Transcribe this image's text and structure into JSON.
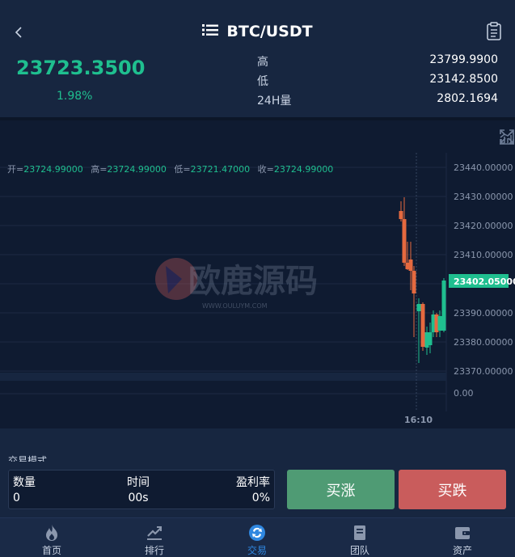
{
  "header": {
    "title": "BTC/USDT",
    "price": "23723.3500",
    "change_pct": "1.98%",
    "stats": [
      {
        "label": "高",
        "value": "23799.9900"
      },
      {
        "label": "低",
        "value": "23142.8500"
      },
      {
        "label": "24H量",
        "value": "2802.1694"
      }
    ]
  },
  "chart": {
    "ohlc_line": [
      {
        "label": "开=",
        "value": "23724.99000"
      },
      {
        "label": "高=",
        "value": "23724.99000"
      },
      {
        "label": "低=",
        "value": "23721.47000"
      },
      {
        "label": "收=",
        "value": "23724.99000"
      }
    ],
    "price_ticks": [
      "23440.00000",
      "23430.00000",
      "23420.00000",
      "23410.00000",
      "23390.00000",
      "23380.00000",
      "23370.00000"
    ],
    "volume_tick": "0.00",
    "current_price_label": "23402.05000",
    "time_label": "16:10",
    "watermark": "欧鹿源码",
    "watermark_sub": "WWW.OULUYM.COM",
    "colors": {
      "up": "#1fbf8f",
      "down": "#e5693f"
    }
  },
  "trade": {
    "mode_label": "交易模式",
    "quantity_label": "数量",
    "quantity_value": "0",
    "time_label": "时间",
    "time_value": "00s",
    "profit_label": "盈利率",
    "profit_value": "0%",
    "buy_up": "买涨",
    "buy_down": "买跌"
  },
  "tabs": [
    {
      "label": "首页",
      "icon": "flame-icon"
    },
    {
      "label": "排行",
      "icon": "ranking-icon"
    },
    {
      "label": "交易",
      "icon": "exchange-icon",
      "active": true
    },
    {
      "label": "团队",
      "icon": "team-icon"
    },
    {
      "label": "资产",
      "icon": "wallet-icon"
    }
  ]
}
